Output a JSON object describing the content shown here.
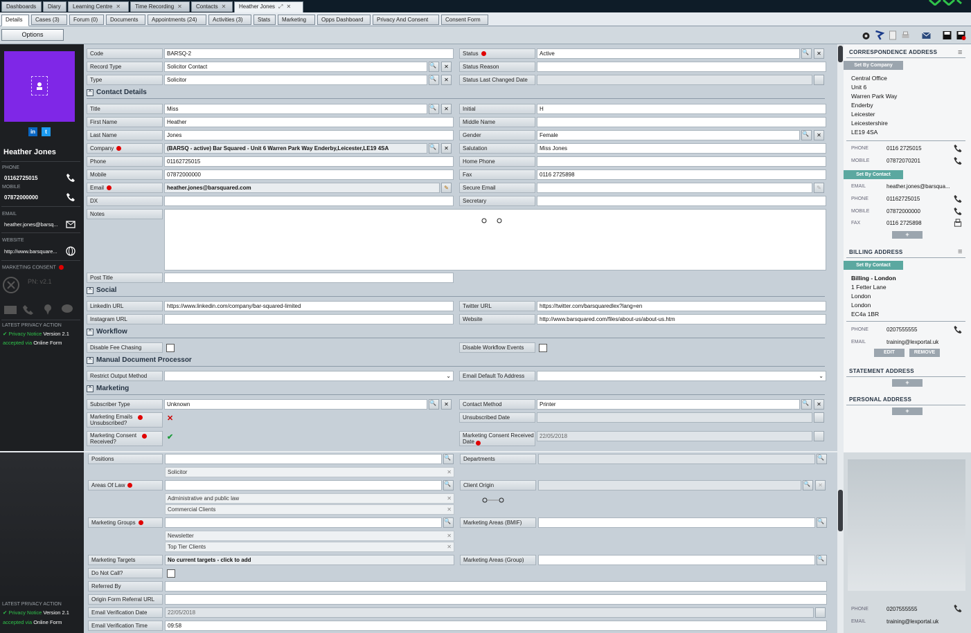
{
  "window_tabs": [
    {
      "label": "Dashboards",
      "closable": false
    },
    {
      "label": "Diary",
      "closable": false
    },
    {
      "label": "Learning Centre",
      "closable": true
    },
    {
      "label": "Time Recording",
      "closable": true
    },
    {
      "label": "Contacts",
      "closable": true
    },
    {
      "label": "Heather Jones",
      "closable": true,
      "active": true
    }
  ],
  "sub_tabs": [
    "Details",
    "Cases (3)",
    "Forum (0)",
    "Documents",
    "Appointments (24)",
    "Activities (3)",
    "Stats",
    "Marketing",
    "Opps Dashboard",
    "Privacy And Consent",
    "Consent Form"
  ],
  "options_label": "Options",
  "left": {
    "social": {
      "linkedin": "in",
      "twitter": "t"
    },
    "name": "Heather Jones",
    "phone_label": "PHONE",
    "phone": "01162725015",
    "mobile_label": "MOBILE",
    "mobile": "07872000000",
    "email_label": "EMAIL",
    "email": "heather.jones@barsq...",
    "website_label": "WEBSITE",
    "website": "http://www.barsquare...",
    "consent_label": "MARKETING CONSENT",
    "pn": "PN: v2.1",
    "privacy_label": "LATEST PRIVACY ACTION",
    "privacy_notice": "Privacy Notice",
    "privacy_version": "Version 2.1",
    "accepted_via": "accepted via",
    "online_form": "Online Form"
  },
  "form": {
    "code": {
      "label": "Code",
      "value": "BARSQ-2"
    },
    "status": {
      "label": "Status",
      "value": "Active"
    },
    "record_type": {
      "label": "Record Type",
      "value": "Solicitor Contact"
    },
    "status_reason": {
      "label": "Status Reason",
      "value": ""
    },
    "type": {
      "label": "Type",
      "value": "Solicitor"
    },
    "status_changed": {
      "label": "Status Last Changed Date",
      "value": ""
    },
    "contact_details": "Contact Details",
    "title": {
      "label": "Title",
      "value": "Miss"
    },
    "initial": {
      "label": "Initial",
      "value": "H"
    },
    "first_name": {
      "label": "First Name",
      "value": "Heather"
    },
    "middle_name": {
      "label": "Middle Name",
      "value": ""
    },
    "last_name": {
      "label": "Last Name",
      "value": "Jones"
    },
    "gender": {
      "label": "Gender",
      "value": "Female"
    },
    "company": {
      "label": "Company",
      "value": "(BARSQ - active) Bar Squared - Unit 6 Warren Park Way Enderby,Leicester,LE19 4SA"
    },
    "salutation": {
      "label": "Salutation",
      "value": "Miss Jones"
    },
    "phone": {
      "label": "Phone",
      "value": "01162725015"
    },
    "home_phone": {
      "label": "Home Phone",
      "value": ""
    },
    "mobile": {
      "label": "Mobile",
      "value": "07872000000"
    },
    "fax": {
      "label": "Fax",
      "value": "0116 2725898"
    },
    "email": {
      "label": "Email",
      "value": "heather.jones@barsquared.com"
    },
    "secure_email": {
      "label": "Secure Email",
      "value": ""
    },
    "dx": {
      "label": "DX",
      "value": ""
    },
    "secretary": {
      "label": "Secretary",
      "value": ""
    },
    "notes": {
      "label": "Notes",
      "value": ""
    },
    "post_title": {
      "label": "Post Title",
      "value": ""
    },
    "social_section": "Social",
    "linkedin": {
      "label": "LinkedIn URL",
      "value": "https://www.linkedin.com/company/bar-squared-limited"
    },
    "twitter": {
      "label": "Twitter URL",
      "value": "https://twitter.com/barsquaredlex?lang=en"
    },
    "instagram": {
      "label": "Instagram URL",
      "value": ""
    },
    "website": {
      "label": "Website",
      "value": "http://www.barsquared.com/files/about-us/about-us.htm"
    },
    "workflow_section": "Workflow",
    "disable_fee": {
      "label": "Disable Fee Chasing"
    },
    "disable_workflow": {
      "label": "Disable Workflow Events"
    },
    "mdp_section": "Manual Document Processor",
    "restrict_output": {
      "label": "Restrict Output Method",
      "value": ""
    },
    "email_default": {
      "label": "Email Default To Address",
      "value": ""
    },
    "marketing_section": "Marketing",
    "subscriber_type": {
      "label": "Subscriber Type",
      "value": "Unknown"
    },
    "contact_method": {
      "label": "Contact Method",
      "value": "Printer"
    },
    "emails_unsub": {
      "label": "Marketing Emails Unsubscribed?"
    },
    "unsub_date": {
      "label": "Unsubscribed Date",
      "value": ""
    },
    "consent_received": {
      "label": "Marketing Consent Received?"
    },
    "consent_date": {
      "label": "Marketing Consent Received Date",
      "value": "22/05/2018"
    },
    "positions": {
      "label": "Positions",
      "chips": [
        "Solicitor"
      ]
    },
    "departments": {
      "label": "Departments"
    },
    "areas_of_law": {
      "label": "Areas Of Law",
      "chips": [
        "Administrative and public law",
        "Commercial Clients"
      ]
    },
    "client_origin": {
      "label": "Client Origin"
    },
    "marketing_groups": {
      "label": "Marketing Groups",
      "chips": [
        "Newsletter",
        "Top Tier Clients"
      ]
    },
    "marketing_areas_bmif": {
      "label": "Marketing Areas (BMIF)"
    },
    "marketing_targets": {
      "label": "Marketing Targets",
      "value": "No current targets - click to add"
    },
    "marketing_areas_group": {
      "label": "Marketing Areas (Group)"
    },
    "do_not_call": {
      "label": "Do Not Call?"
    },
    "referred_by": {
      "label": "Referred By",
      "value": ""
    },
    "origin_referral": {
      "label": "Origin Form Referral URL",
      "value": ""
    },
    "email_verif_date": {
      "label": "Email Verification Date",
      "value": "22/05/2018"
    },
    "email_verif_time": {
      "label": "Email Verification Time",
      "value": "09:58"
    }
  },
  "right": {
    "corr_head": "CORRESPONDENCE ADDRESS",
    "set_by_company": "Set By Company",
    "corr_address": [
      "Central Office",
      "Unit 6",
      "Warren Park Way",
      "Enderby",
      "Leicester",
      "Leicestershire",
      "LE19 4SA"
    ],
    "phone_label": "PHONE",
    "mobile_label": "MOBILE",
    "email_label": "EMAIL",
    "fax_label": "FAX",
    "corr_phone": "0116 2725015",
    "corr_mobile": "07872070201",
    "set_by_contact": "Set By Contact",
    "c_email": "heather.jones@barsqua...",
    "c_phone": "01162725015",
    "c_mobile": "07872000000",
    "c_fax": "0116 2725898",
    "plus": "+",
    "billing_head": "BILLING ADDRESS",
    "billing_address": [
      "Billing - London",
      "1 Fetter Lane",
      "London",
      "London",
      "EC4a 1BR"
    ],
    "b_phone": "0207555555",
    "b_email": "training@lexportal.uk",
    "edit": "EDIT",
    "remove": "REMOVE",
    "statement_head": "STATEMENT ADDRESS",
    "personal_head": "PERSONAL ADDRESS",
    "bottom_phone": "0207555555",
    "bottom_email": "training@lexportal.uk"
  },
  "colors": {
    "accent": "#7f27e7",
    "teal": "#5ba8a0",
    "required": "#e00000"
  }
}
